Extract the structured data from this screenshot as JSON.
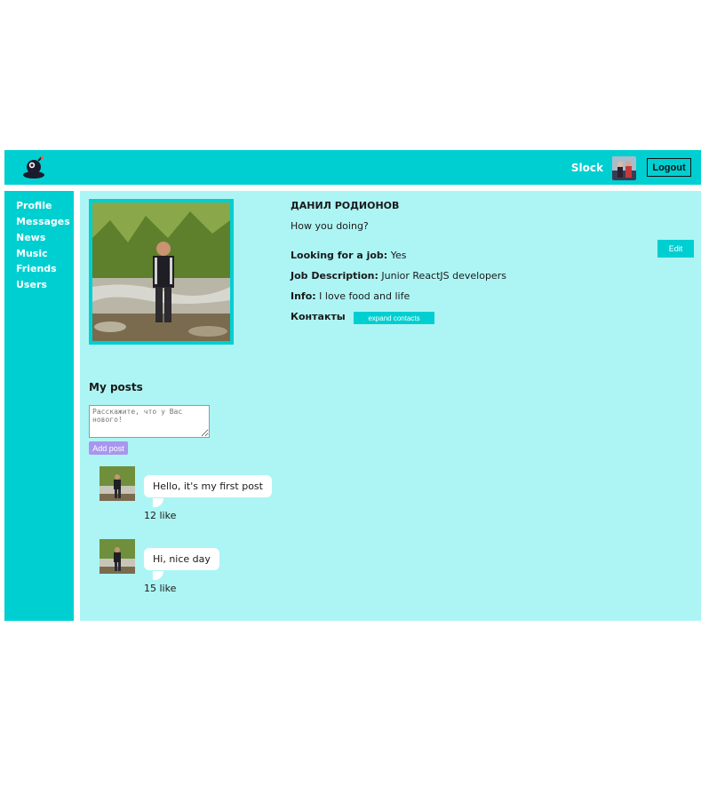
{
  "header": {
    "login_name": "Slock",
    "logout_label": "Logout"
  },
  "sidebar": {
    "items": [
      {
        "label": "Profile"
      },
      {
        "label": "Messages"
      },
      {
        "label": "News"
      },
      {
        "label": "Music"
      },
      {
        "label": "Friends"
      },
      {
        "label": "Users"
      }
    ]
  },
  "profile": {
    "full_name": "ДАНИЛ РОДИОНОВ",
    "status": "How you doing?",
    "looking_for_job_label": "Looking for a job:",
    "looking_for_job_value": "Yes",
    "job_description_label": "Job Description:",
    "job_description_value": "Junior ReactJS developers",
    "info_label": "Info:",
    "info_value": "I love food and life",
    "contacts_label": "Контакты",
    "expand_contacts_label": "expand contacts",
    "edit_label": "Edit"
  },
  "posts": {
    "title": "My posts",
    "input_placeholder": "Расскажите, что у Вас нового!",
    "add_label": "Add post",
    "items": [
      {
        "text": "Hello, it's my first post",
        "likes": "12 like"
      },
      {
        "text": "Hi, nice day",
        "likes": "15 like"
      }
    ]
  },
  "colors": {
    "accent": "#00cfd1",
    "content_bg": "#adf5f4",
    "add_button": "#a896ee"
  },
  "icons": {
    "logo": "astronaut-logo-icon"
  }
}
